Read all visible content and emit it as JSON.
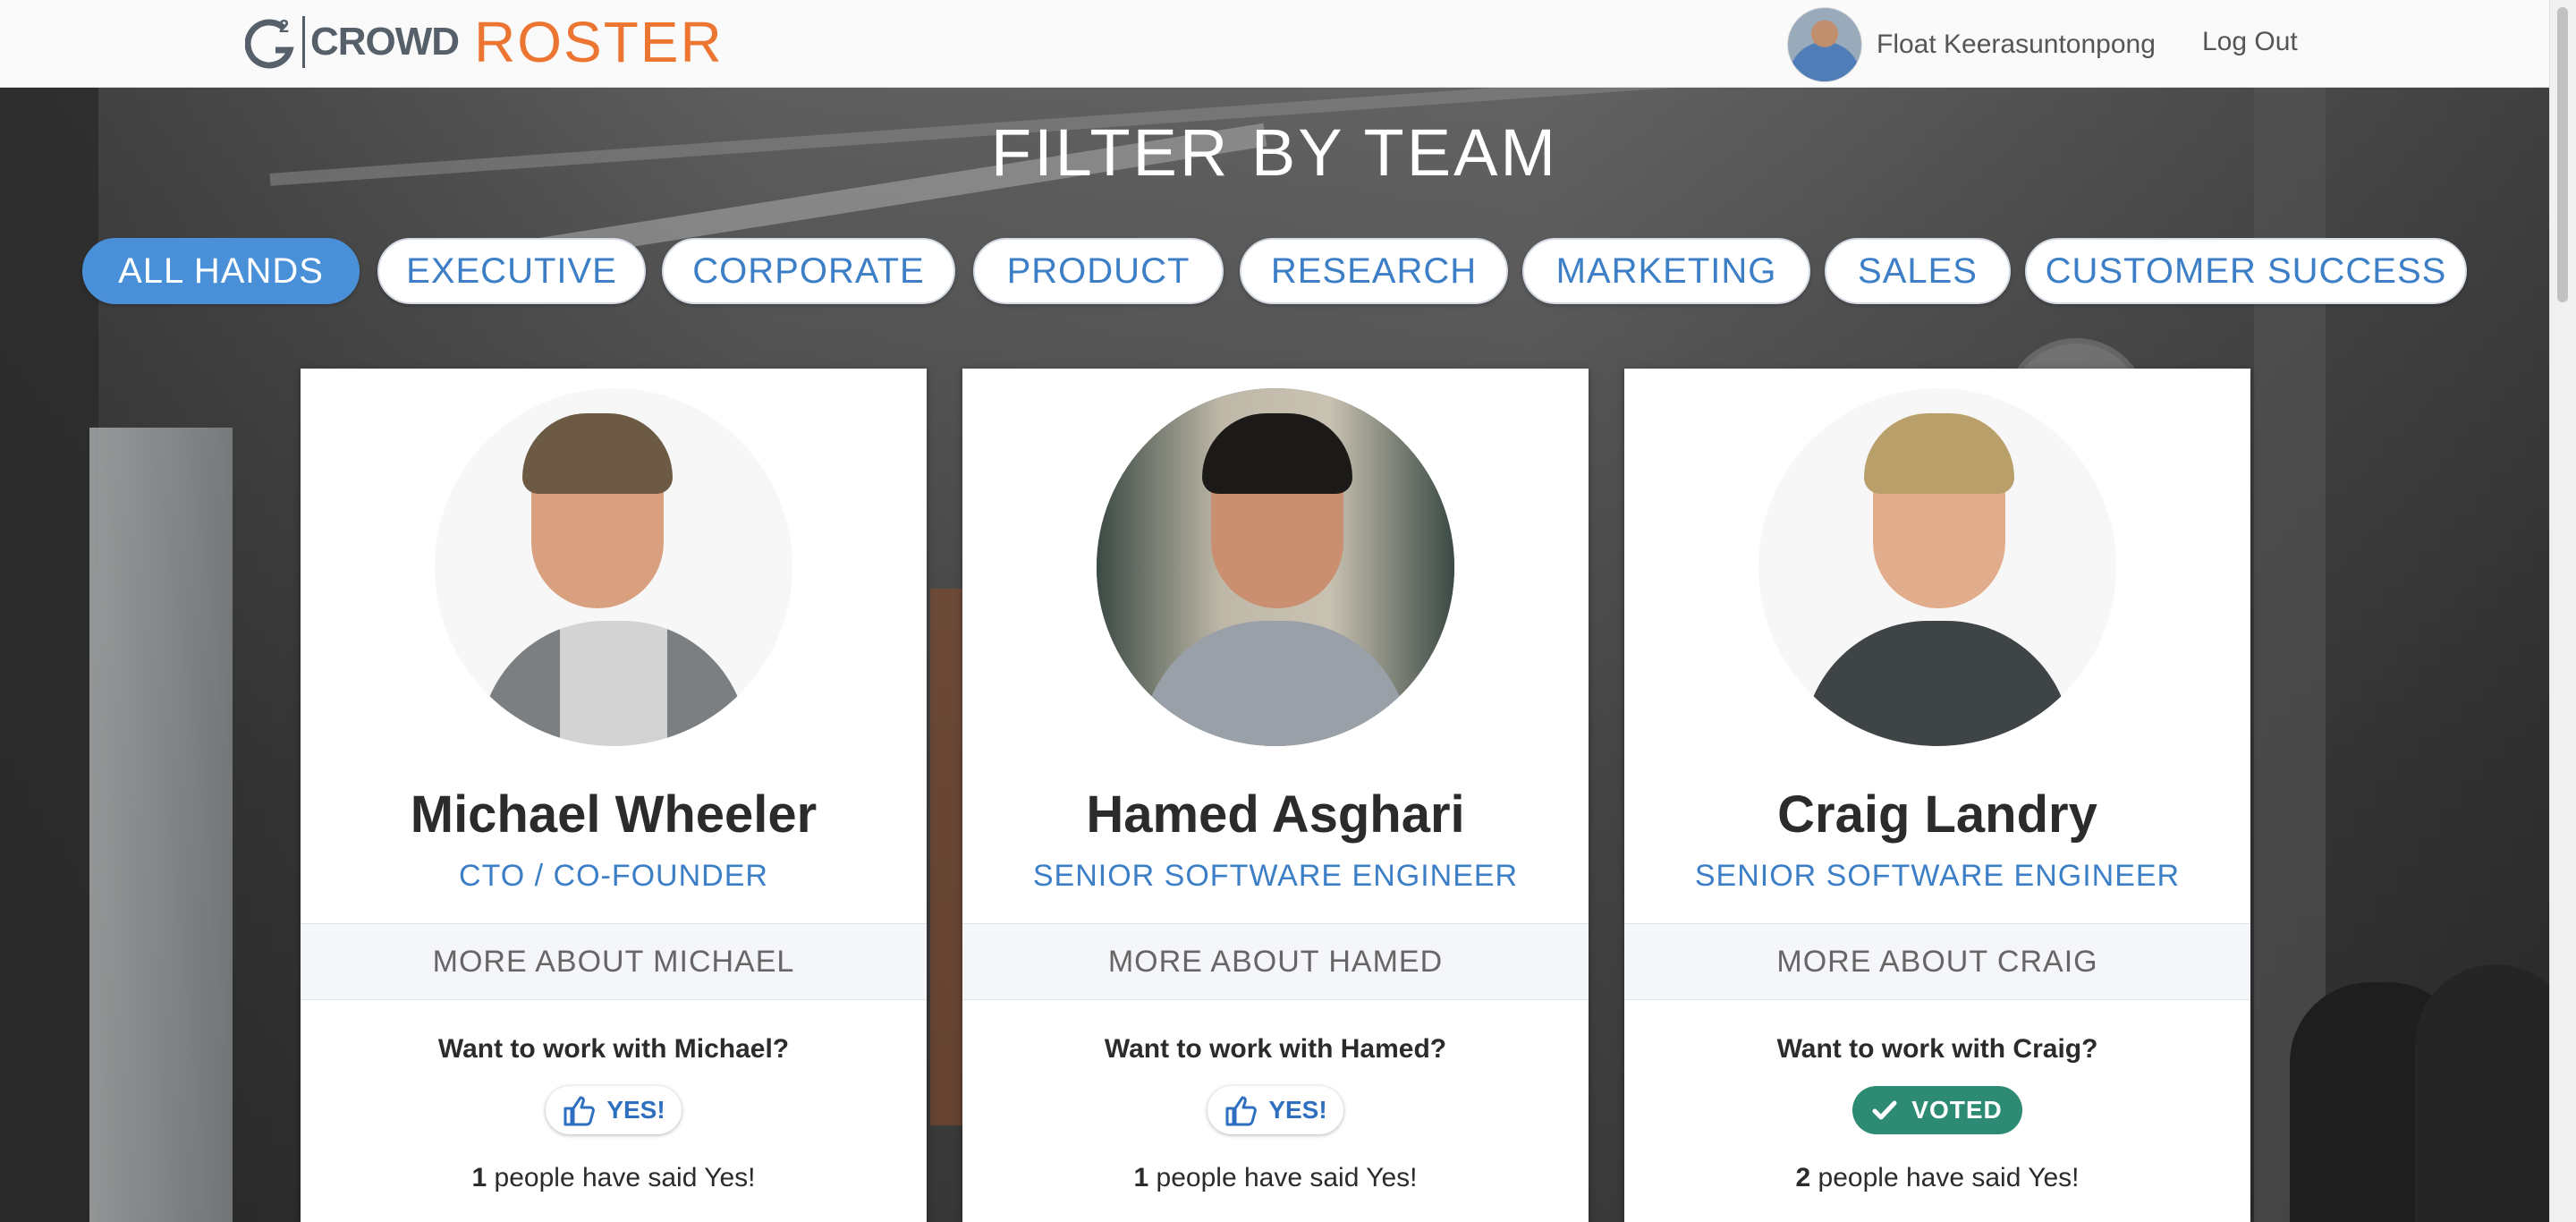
{
  "header": {
    "logo_superscript": "2",
    "logo_letter": "G",
    "logo_text": "CROWD",
    "app_name": "ROSTER",
    "user_name": "Float Keerasuntonpong",
    "logout_label": "Log Out"
  },
  "filter": {
    "heading": "FILTER BY TEAM",
    "teams": [
      {
        "label": "ALL HANDS",
        "active": true
      },
      {
        "label": "EXECUTIVE",
        "active": false
      },
      {
        "label": "CORPORATE",
        "active": false
      },
      {
        "label": "PRODUCT",
        "active": false
      },
      {
        "label": "RESEARCH",
        "active": false
      },
      {
        "label": "MARKETING",
        "active": false
      },
      {
        "label": "SALES",
        "active": false
      },
      {
        "label": "CUSTOMER SUCCESS",
        "active": false
      }
    ]
  },
  "people": [
    {
      "name": "Michael Wheeler",
      "title": "CTO / CO-FOUNDER",
      "more_label": "MORE ABOUT MICHAEL",
      "question": "Want to work with Michael?",
      "vote_state": "yes",
      "vote_label": "YES!",
      "count": "1",
      "count_suffix": " people have said Yes!"
    },
    {
      "name": "Hamed Asghari",
      "title": "SENIOR SOFTWARE ENGINEER",
      "more_label": "MORE ABOUT HAMED",
      "question": "Want to work with Hamed?",
      "vote_state": "yes",
      "vote_label": "YES!",
      "count": "1",
      "count_suffix": " people have said Yes!"
    },
    {
      "name": "Craig Landry",
      "title": "SENIOR SOFTWARE ENGINEER",
      "more_label": "MORE ABOUT CRAIG",
      "question": "Want to work with Craig?",
      "vote_state": "voted",
      "vote_label": "VOTED",
      "count": "2",
      "count_suffix": " people have said Yes!"
    }
  ],
  "colors": {
    "brand_orange": "#ec7631",
    "accent_blue": "#3c7fc7",
    "active_pill": "#4a90d9",
    "voted_green": "#2e8b73"
  }
}
